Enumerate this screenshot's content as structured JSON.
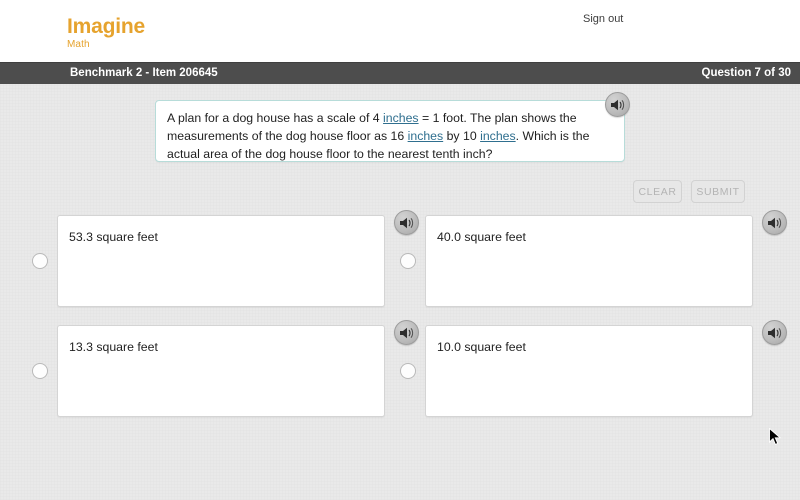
{
  "header": {
    "logo_main": "Imagine",
    "logo_sub": "Math",
    "signout_label": "Sign out"
  },
  "statusbar": {
    "benchmark_label": "Benchmark 2 - Item 206645",
    "question_counter": "Question 7 of 30"
  },
  "question": {
    "segments": [
      {
        "text": "A plan for a dog house has a scale of 4 ",
        "gloss": false
      },
      {
        "text": "inches",
        "gloss": true
      },
      {
        "text": " = 1 foot. The plan shows the measurements of the dog house floor as 16 ",
        "gloss": false
      },
      {
        "text": "inches",
        "gloss": true
      },
      {
        "text": " by 10 ",
        "gloss": false
      },
      {
        "text": "inches",
        "gloss": true
      },
      {
        "text": ". Which is the actual area of the dog house floor to the nearest tenth inch?",
        "gloss": false
      }
    ],
    "speaker_icon": "speaker-icon"
  },
  "actions": {
    "clear_label": "CLEAR",
    "submit_label": "SUBMIT",
    "clear_enabled": false,
    "submit_enabled": false
  },
  "options": [
    {
      "label": "53.3 square feet",
      "selected": false,
      "speaker_icon": "speaker-icon"
    },
    {
      "label": "40.0 square feet",
      "selected": false,
      "speaker_icon": "speaker-icon"
    },
    {
      "label": "13.3 square feet",
      "selected": false,
      "speaker_icon": "speaker-icon"
    },
    {
      "label": "10.0 square feet",
      "selected": false,
      "speaker_icon": "speaker-icon"
    }
  ],
  "colors": {
    "brand_orange": "#e6a32e",
    "statusbar_bg": "#4d4d4d",
    "stage_bg": "#e9e9e9",
    "panel_border": "#b7dcd9",
    "gloss_link": "#2f6f8f"
  }
}
